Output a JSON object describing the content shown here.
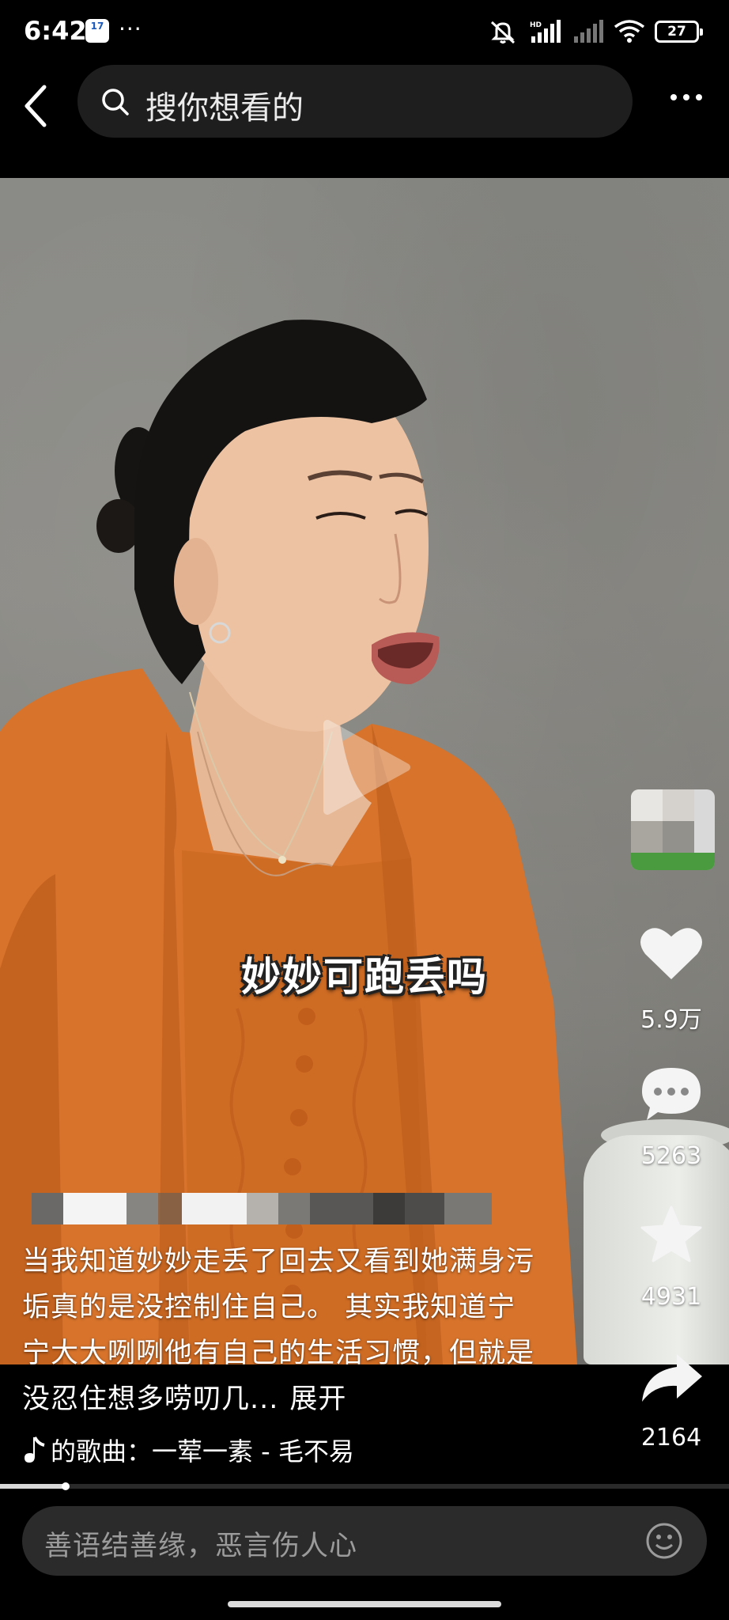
{
  "status_bar": {
    "time": "6:42",
    "badge_text": "17",
    "more": "···",
    "battery": "27",
    "icons": [
      "mute-icon",
      "hd-signal-icon",
      "signal-icon",
      "wifi-icon",
      "battery-icon"
    ]
  },
  "search": {
    "placeholder": "搜你想看的"
  },
  "video": {
    "subtitle": "妙妙可跑丢吗",
    "progress": 0.09
  },
  "actions": {
    "likes": "5.9万",
    "comments": "5263",
    "favorites": "4931",
    "shares": "2164"
  },
  "post": {
    "caption": "当我知道妙妙走丢了回去又看到她满身污垢真的是没控制住自己。 其实我知道宁宁大大咧咧他有自己的生活习惯，但就是没忍住想多唠叨几...",
    "expand_label": "展开",
    "music_label": "的歌曲：一荤一素 - 毛不易"
  },
  "comment_box": {
    "placeholder": "善语结善缘，恶言伤人心"
  },
  "colors": {
    "background": "#000000",
    "search_bg": "#1e1e1e",
    "comment_bg": "#2b2b2b",
    "sweater": "#d9742c"
  }
}
